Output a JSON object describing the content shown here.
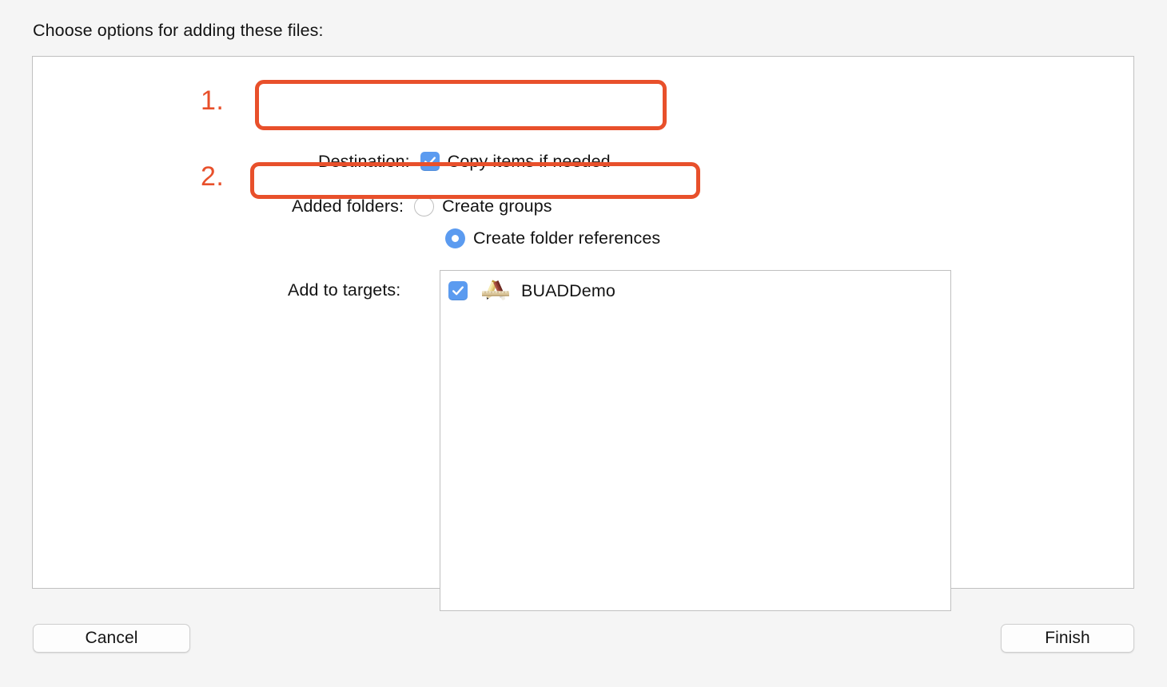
{
  "dialog": {
    "heading": "Choose options for adding these files:"
  },
  "options": {
    "destination": {
      "label": "Destination:",
      "checkbox_label": "Copy items if needed",
      "checked": true,
      "icon": "checkbox-checked-icon"
    },
    "added_folders": {
      "label": "Added folders:",
      "choices": [
        {
          "label": "Create groups",
          "selected": false,
          "icon": "radio-unselected-icon"
        },
        {
          "label": "Create folder references",
          "selected": true,
          "icon": "radio-selected-icon"
        }
      ]
    },
    "add_to_targets": {
      "label": "Add to targets:",
      "targets": [
        {
          "name": "BUADDemo",
          "checked": true,
          "icon": "xcode-app-icon"
        }
      ]
    }
  },
  "annotations": {
    "accent_color": "#e8502b",
    "markers": [
      {
        "number": "1.",
        "target": "destination-row"
      },
      {
        "number": "2.",
        "target": "create-folder-references-row"
      }
    ]
  },
  "footer": {
    "cancel_label": "Cancel",
    "finish_label": "Finish"
  },
  "colors": {
    "background": "#f5f5f5",
    "panel_background": "#ffffff",
    "panel_border": "#c0c0c0",
    "control_blue": "#5b9bf0",
    "annotation_red": "#e8502b",
    "text": "#131313"
  }
}
